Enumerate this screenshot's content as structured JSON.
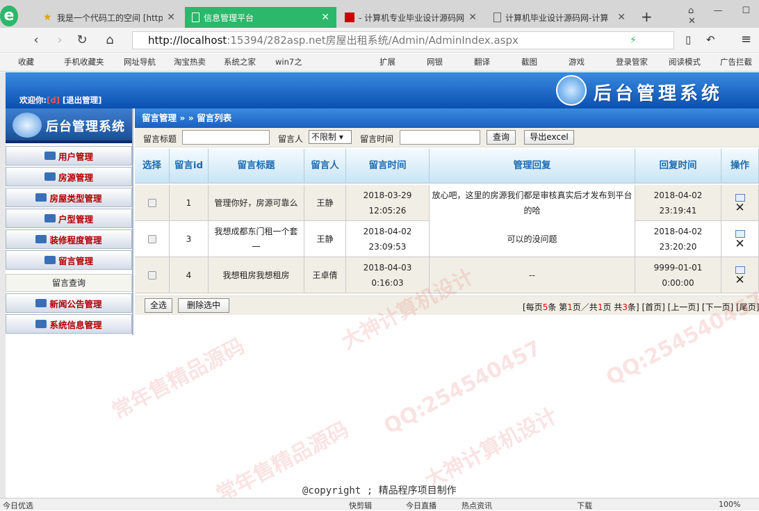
{
  "browser": {
    "tabs": [
      {
        "title": "我是一个代码工的空间 [http"
      },
      {
        "title": "信息管理平台"
      },
      {
        "title": "- 计算机专业毕业设计源码网"
      },
      {
        "title": "计算机毕业设计源码网-计算"
      }
    ],
    "url_host": "http://localhost",
    "url_path": ":15394/282asp.net房屋出租系统/Admin/AdminIndex.aspx",
    "bookmarks": [
      "收藏",
      "手机收藏夹",
      "网址导航",
      "淘宝热卖",
      "系统之家",
      "win7之",
      "扩展",
      "网银",
      "翻译",
      "截图",
      "游戏",
      "登录管家",
      "阅读模式",
      "广告拦截"
    ],
    "status": {
      "left": "今日优选",
      "items": [
        "快剪辑",
        "今日直播",
        "热点资讯",
        "下载"
      ],
      "zoom": "100%"
    }
  },
  "header": {
    "welcome": "欢迎你:",
    "user": "[d]",
    "logout": "[退出管理]",
    "system_title": "后台管理系统"
  },
  "sidebar": {
    "logo_title": "后台管理系统",
    "menu": [
      "用户管理",
      "房源管理",
      "房屋类型管理",
      "户型管理",
      "装修程度管理",
      "留言管理",
      "新闻公告管理",
      "系统信息管理"
    ],
    "submenu": "留言查询"
  },
  "breadcrumb": "留言管理 » » 留言列表",
  "search": {
    "title_label": "留言标题",
    "title_value": "",
    "person_label": "留言人",
    "person_selected": "不限制",
    "time_label": "留言时间",
    "time_value": "",
    "query_btn": "查询",
    "export_btn": "导出excel"
  },
  "table": {
    "headers": [
      "选择",
      "留言id",
      "留言标题",
      "留言人",
      "留言时间",
      "管理回复",
      "回复时间",
      "操作"
    ],
    "rows": [
      {
        "id": "1",
        "title": "管理你好，房源可靠么",
        "person": "王静",
        "time": "2018-03-29 12:05:26",
        "reply": "放心吧，这里的房源我们都是审核真实后才发布到平台的哈",
        "reply_time": "2018-04-02 23:19:41"
      },
      {
        "id": "3",
        "title": "我想成都东门租一个套一",
        "person": "王静",
        "time": "2018-04-02 23:09:53",
        "reply": "可以的没问题",
        "reply_time": "2018-04-02 23:20:20"
      },
      {
        "id": "4",
        "title": "我想租房我想租房",
        "person": "王卓倩",
        "time": "2018-04-03 0:16:03",
        "reply": "--",
        "reply_time": "9999-01-01 0:00:00"
      }
    ]
  },
  "footer": {
    "select_all": "全选",
    "delete_selected": "删除选中",
    "pager_prefix": "[每页",
    "page_size": "5",
    "pager_mid1": "条 第",
    "page_current": "1",
    "pager_mid2": "页／共",
    "page_total": "1",
    "pager_mid3": "页 共",
    "record_total": "3",
    "pager_suffix": "条]",
    "first": "[首页]",
    "prev": "[上一页]",
    "next": "[下一页]",
    "last": "[尾页]"
  },
  "copyright": "@copyright ; 精品程序项目制作",
  "watermarks": [
    "常年售精品源码",
    "QQ:254540457",
    "大神计算机设计"
  ]
}
